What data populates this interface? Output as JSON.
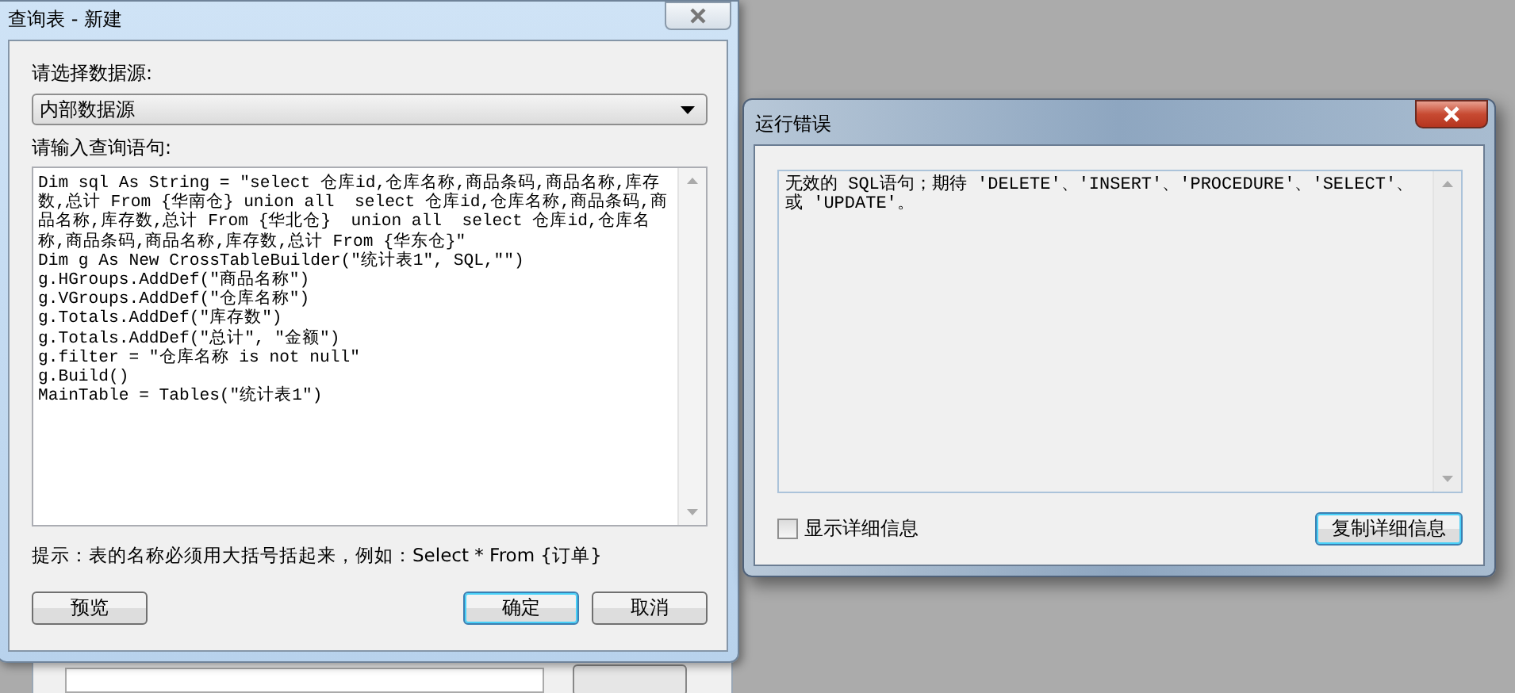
{
  "query_dialog": {
    "title": "查询表 - 新建",
    "datasource_label": "请选择数据源:",
    "datasource": {
      "value": "内部数据源"
    },
    "query_label": "请输入查询语句:",
    "query_lines": [
      "Dim sql As String = \"select 仓库id,仓库名称,商品条码,商品名称,库存数,总计 From {华南仓} union all  select 仓库id,仓库名称,商品条码,商品名称,库存数,总计 From {华北仓}  union all  select 仓库id,仓库名称,商品条码,商品名称,库存数,总计 From {华东仓}\"",
      "Dim g As New CrossTableBuilder(\"统计表1\", SQL,\"\")",
      "g.HGroups.AddDef(\"商品名称\")",
      "g.VGroups.AddDef(\"仓库名称\")",
      "g.Totals.AddDef(\"库存数\")",
      "g.Totals.AddDef(\"总计\", \"金额\")",
      "g.filter = \"仓库名称 is not null\"",
      "g.Build()",
      "MainTable = Tables(\"统计表1\")"
    ],
    "hint": "提示：表的名称必须用大括号括起来，例如：Select * From {订单}",
    "buttons": [
      {
        "label": "预览",
        "default": false
      },
      {
        "label": "确定",
        "default": true
      },
      {
        "label": "取消",
        "default": false
      }
    ]
  },
  "error_dialog": {
    "title": "运行错误",
    "message": "无效的 SQL语句；期待 'DELETE'、'INSERT'、'PROCEDURE'、'SELECT'、或 'UPDATE'。",
    "show_details": {
      "label": "显示详细信息",
      "checked": false
    },
    "copy_button": {
      "label": "复制详细信息",
      "default": true
    }
  }
}
